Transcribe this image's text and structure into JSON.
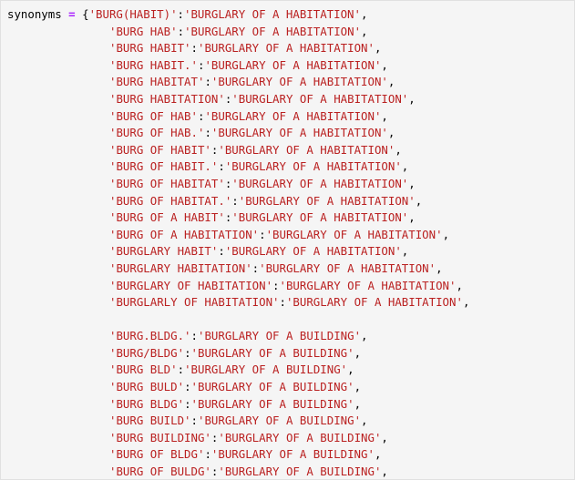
{
  "code": {
    "variable": "synonyms",
    "operator": "=",
    "open_brace": "{",
    "colon": ":",
    "comma": ",",
    "groups": [
      {
        "entries": [
          {
            "key": "'BURG(HABIT)'",
            "value": "'BURGLARY OF A HABITATION'"
          },
          {
            "key": "'BURG HAB'",
            "value": "'BURGLARY OF A HABITATION'"
          },
          {
            "key": "'BURG HABIT'",
            "value": "'BURGLARY OF A HABITATION'"
          },
          {
            "key": "'BURG HABIT.'",
            "value": "'BURGLARY OF A HABITATION'"
          },
          {
            "key": "'BURG HABITAT'",
            "value": "'BURGLARY OF A HABITATION'"
          },
          {
            "key": "'BURG HABITATION'",
            "value": "'BURGLARY OF A HABITATION'"
          },
          {
            "key": "'BURG OF HAB'",
            "value": "'BURGLARY OF A HABITATION'"
          },
          {
            "key": "'BURG OF HAB.'",
            "value": "'BURGLARY OF A HABITATION'"
          },
          {
            "key": "'BURG OF HABIT'",
            "value": "'BURGLARY OF A HABITATION'"
          },
          {
            "key": "'BURG OF HABIT.'",
            "value": "'BURGLARY OF A HABITATION'"
          },
          {
            "key": "'BURG OF HABITAT'",
            "value": "'BURGLARY OF A HABITATION'"
          },
          {
            "key": "'BURG OF HABITAT.'",
            "value": "'BURGLARY OF A HABITATION'"
          },
          {
            "key": "'BURG OF A HABIT'",
            "value": "'BURGLARY OF A HABITATION'"
          },
          {
            "key": "'BURG OF A HABITATION'",
            "value": "'BURGLARY OF A HABITATION'"
          },
          {
            "key": "'BURGLARY HABIT'",
            "value": "'BURGLARY OF A HABITATION'"
          },
          {
            "key": "'BURGLARY HABITATION'",
            "value": "'BURGLARY OF A HABITATION'"
          },
          {
            "key": "'BURGLARY OF HABITATION'",
            "value": "'BURGLARY OF A HABITATION'"
          },
          {
            "key": "'BURGLARLY OF HABITATION'",
            "value": "'BURGLARY OF A HABITATION'"
          }
        ]
      },
      {
        "entries": [
          {
            "key": "'BURG.BLDG.'",
            "value": "'BURGLARY OF A BUILDING'"
          },
          {
            "key": "'BURG/BLDG'",
            "value": "'BURGLARY OF A BUILDING'"
          },
          {
            "key": "'BURG BLD'",
            "value": "'BURGLARY OF A BUILDING'"
          },
          {
            "key": "'BURG BULD'",
            "value": "'BURGLARY OF A BUILDING'"
          },
          {
            "key": "'BURG BLDG'",
            "value": "'BURGLARY OF A BUILDING'"
          },
          {
            "key": "'BURG BUILD'",
            "value": "'BURGLARY OF A BUILDING'"
          },
          {
            "key": "'BURG BUILDING'",
            "value": "'BURGLARY OF A BUILDING'"
          },
          {
            "key": "'BURG OF BLDG'",
            "value": "'BURGLARY OF A BUILDING'"
          },
          {
            "key": "'BURG OF BULDG'",
            "value": "'BURGLARY OF A BUILDING'"
          }
        ]
      }
    ]
  },
  "colors": {
    "string": "#ba2121",
    "operator": "#aa22ff",
    "background": "#f5f5f5"
  }
}
